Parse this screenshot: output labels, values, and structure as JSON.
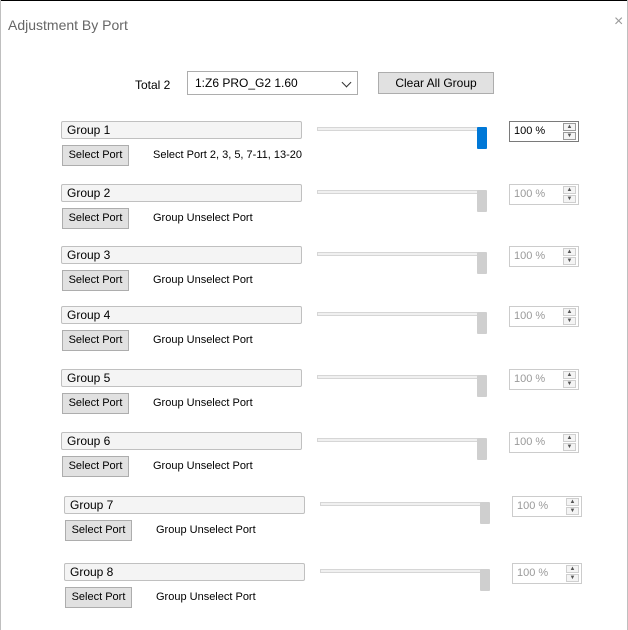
{
  "dialog": {
    "title": "Adjustment By Port",
    "close_glyph": "×"
  },
  "toolbar": {
    "total_label": "Total 2",
    "device_select": {
      "value": "1:Z6 PRO_G2 1.60"
    },
    "clear_all_label": "Clear All Group"
  },
  "groups": [
    {
      "name": "Group 1",
      "select_label": "Select Port",
      "port_text": "Select Port 2, 3, 5, 7-11, 13-20",
      "level_text": "100 %",
      "level": 100,
      "active": true
    },
    {
      "name": "Group 2",
      "select_label": "Select Port",
      "port_text": "Group  Unselect Port",
      "level_text": "100 %",
      "level": 100,
      "active": false
    },
    {
      "name": "Group 3",
      "select_label": "Select Port",
      "port_text": "Group  Unselect Port",
      "level_text": "100 %",
      "level": 100,
      "active": false
    },
    {
      "name": "Group 4",
      "select_label": "Select Port",
      "port_text": "Group  Unselect Port",
      "level_text": "100 %",
      "level": 100,
      "active": false
    },
    {
      "name": "Group 5",
      "select_label": "Select Port",
      "port_text": "Group  Unselect Port",
      "level_text": "100 %",
      "level": 100,
      "active": false
    },
    {
      "name": "Group 6",
      "select_label": "Select Port",
      "port_text": "Group  Unselect Port",
      "level_text": "100 %",
      "level": 100,
      "active": false
    },
    {
      "name": "Group 7",
      "select_label": "Select Port",
      "port_text": "Group  Unselect Port",
      "level_text": "100 %",
      "level": 100,
      "active": false
    },
    {
      "name": "Group 8",
      "select_label": "Select Port",
      "port_text": "Group  Unselect Port",
      "level_text": "100 %",
      "level": 100,
      "active": false
    }
  ],
  "colors": {
    "active_slider": "#0078d7",
    "disabled_slider": "#cfcfcf"
  }
}
